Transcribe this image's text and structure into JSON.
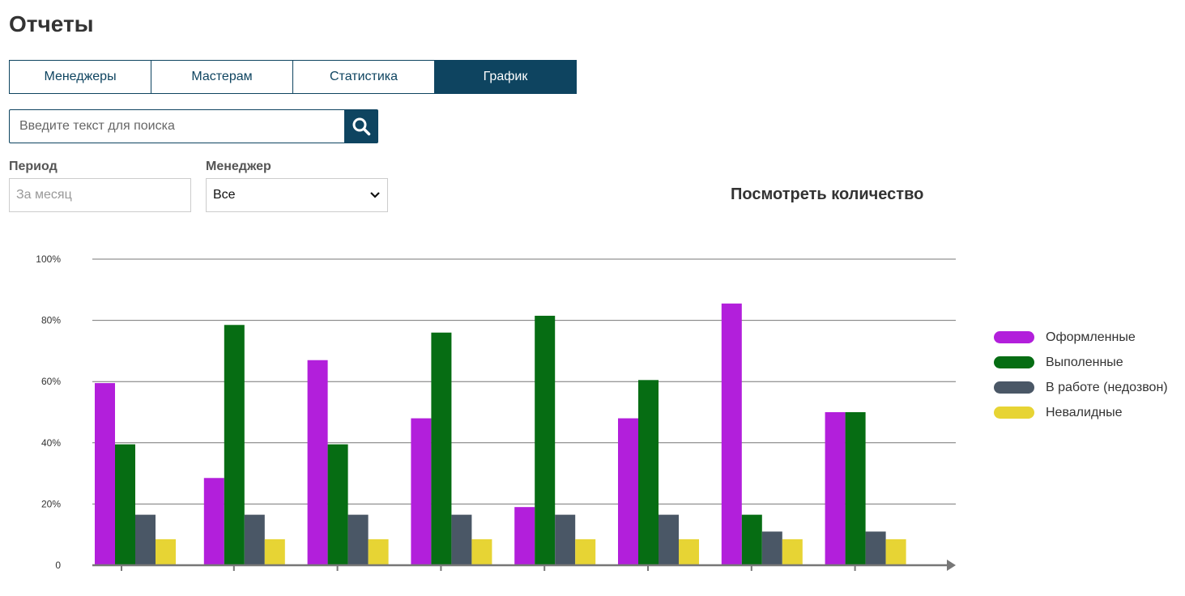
{
  "page": {
    "title": "Отчеты"
  },
  "tabs": [
    {
      "label": "Менеджеры",
      "active": false
    },
    {
      "label": "Мастерам",
      "active": false
    },
    {
      "label": "Статистика",
      "active": false
    },
    {
      "label": "График",
      "active": true
    }
  ],
  "search": {
    "placeholder": "Введите текст для поиска",
    "value": "",
    "icon": "search-icon"
  },
  "filters": {
    "period": {
      "label": "Период",
      "placeholder": "За месяц",
      "value": ""
    },
    "manager": {
      "label": "Менеджер",
      "selected": "Все"
    }
  },
  "view_title": "Посмотреть количество",
  "colors": {
    "primary": "#0e4460"
  },
  "chart_data": {
    "type": "bar",
    "title": "",
    "xlabel": "",
    "ylabel": "",
    "ylim": [
      0,
      100
    ],
    "yticks": [
      "0",
      "20%",
      "40%",
      "60%",
      "80%",
      "100%"
    ],
    "grid": true,
    "legend_position": "right",
    "categories": [
      "",
      "",
      "",
      "",
      "",
      "",
      "",
      ""
    ],
    "series": [
      {
        "name": "Оформленные",
        "color": "#b21fdb",
        "values": [
          59.5,
          28.5,
          67,
          48,
          19,
          48,
          85.5,
          50
        ]
      },
      {
        "name": "Выполенные",
        "color": "#066d13",
        "values": [
          39.5,
          78.5,
          39.5,
          76,
          81.5,
          60.5,
          16.5,
          50
        ]
      },
      {
        "name": "В работе (недозвон)",
        "color": "#4a5766",
        "values": [
          16.5,
          16.5,
          16.5,
          16.5,
          16.5,
          16.5,
          11,
          11
        ]
      },
      {
        "name": "Невалидные",
        "color": "#e7d434",
        "values": [
          8.5,
          8.5,
          8.5,
          8.5,
          8.5,
          8.5,
          8.5,
          8.5
        ]
      }
    ]
  }
}
